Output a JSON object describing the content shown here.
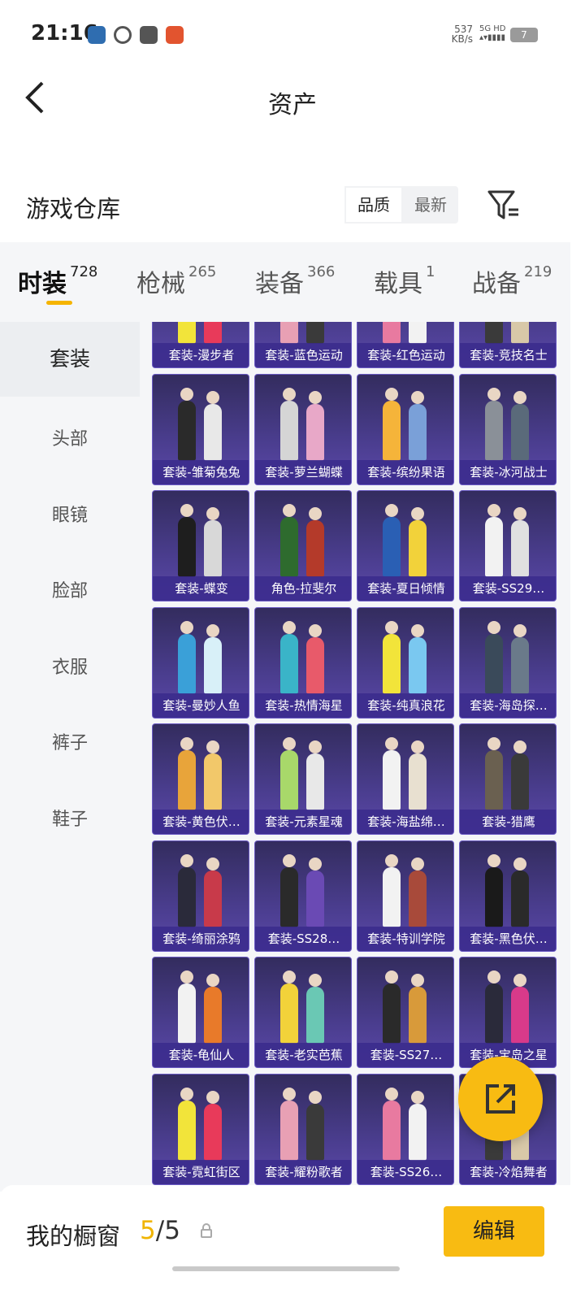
{
  "status_bar": {
    "time": "21:16",
    "net_speed_value": "537",
    "net_speed_unit": "KB/s",
    "network": "5G HD",
    "battery": "7"
  },
  "header": {
    "title": "资产"
  },
  "warehouse": {
    "title": "游戏仓库",
    "sort_options": [
      "品质",
      "最新"
    ],
    "active_sort": "品质"
  },
  "tabs": [
    {
      "label": "时装",
      "count": "728"
    },
    {
      "label": "枪械",
      "count": "265"
    },
    {
      "label": "装备",
      "count": "366"
    },
    {
      "label": "载具",
      "count": "1"
    },
    {
      "label": "战备",
      "count": "219"
    }
  ],
  "sidebar": {
    "items": [
      "套装",
      "头部",
      "眼镜",
      "脸部",
      "衣服",
      "裤子",
      "鞋子"
    ],
    "active": "套装"
  },
  "items": [
    "套装-漫步者",
    "套装-蓝色运动",
    "套装-红色运动",
    "套装-竞技名士",
    "套装-雏菊兔兔",
    "套装-萝兰蝴蝶",
    "套装-缤纷果语",
    "套装-冰河战士",
    "套装-蝶变",
    "角色-拉斐尔",
    "套装-夏日倾情",
    "套装-SS29…",
    "套装-曼妙人鱼",
    "套装-热情海星",
    "套装-纯真浪花",
    "套装-海岛探…",
    "套装-黄色伏…",
    "套装-元素星魂",
    "套装-海盐绵…",
    "套装-猎鹰",
    "套装-绮丽涂鸦",
    "套装-SS28…",
    "套装-特训学院",
    "套装-黑色伏…",
    "套装-龟仙人",
    "套装-老实芭蕉",
    "套装-SS27…",
    "套装-宝岛之星",
    "套装-霓虹街区",
    "套装-耀粉歌者",
    "套装-SS26…",
    "套装-冷焰舞者"
  ],
  "showcase": {
    "title": "我的橱窗",
    "current": "5",
    "separator": "/",
    "total": "5",
    "edit_label": "编辑"
  },
  "icons": {
    "back": "back-chevron-icon",
    "filter": "filter-icon",
    "share": "share-external-icon",
    "lock": "lock-icon"
  },
  "colors": {
    "accent": "#f8bb12",
    "count_highlight": "#f0b400",
    "card_bg": "#4a3d8e"
  }
}
